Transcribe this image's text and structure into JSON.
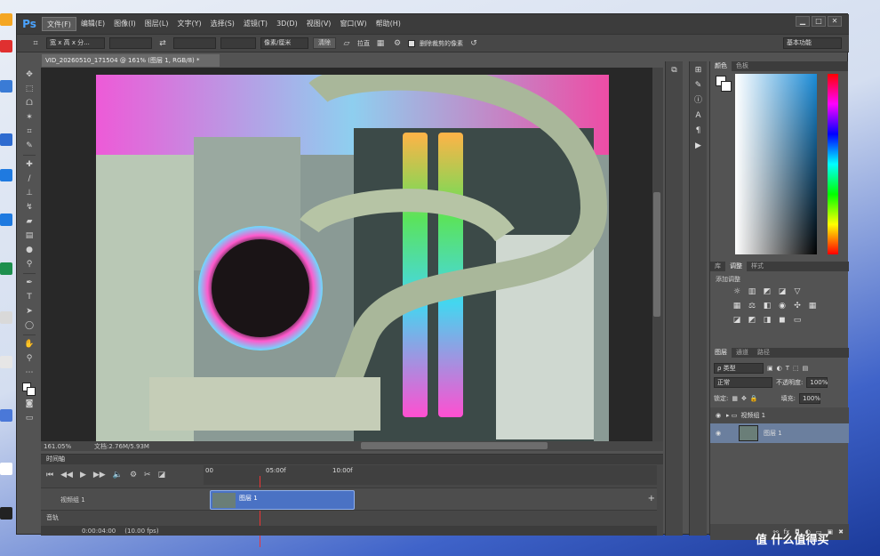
{
  "app": {
    "logo": "Ps"
  },
  "menus": [
    "文件(F)",
    "编辑(E)",
    "图像(I)",
    "图层(L)",
    "文字(Y)",
    "选择(S)",
    "滤镜(T)",
    "3D(D)",
    "视图(V)",
    "窗口(W)",
    "帮助(H)"
  ],
  "window_buttons": {
    "min": "▁",
    "max": "□",
    "close": "✕"
  },
  "options": {
    "ratio": "宽 x 高 x 分...",
    "unit": "像素/厘米",
    "clear": "清除",
    "straighten": "拉直",
    "delete_cropped": "删除裁剪的像素",
    "workspace": "基本功能"
  },
  "document": {
    "tab": "VID_20260510_171504 @ 161% (图层 1, RGB/8) *"
  },
  "status": {
    "zoom": "161.05%",
    "doc": "文档:2.76M/5.93M"
  },
  "timeline": {
    "title": "时间轴",
    "t0": "00",
    "t1": "05:00f",
    "t2": "10:00f",
    "group": "视频组 1",
    "clip": "图层 1",
    "audio": "音轨",
    "time": "0:00:04:00",
    "fps": "(10.00 fps)"
  },
  "panels": {
    "color_tabs": [
      "颜色",
      "色板"
    ],
    "adj_tabs": [
      "库",
      "调整",
      "样式"
    ],
    "adj_title": "添加调整",
    "layer_tabs": [
      "图层",
      "通道",
      "路径"
    ],
    "kind": "ρ 类型",
    "blend": "正常",
    "opacity_label": "不透明度:",
    "opacity": "100%",
    "lock_label": "锁定:",
    "fill_label": "填充:",
    "fill": "100%",
    "group_name": "视频组 1",
    "layer_name": "图层 1"
  },
  "taskbar": {
    "brand": "值 什么值得买"
  }
}
